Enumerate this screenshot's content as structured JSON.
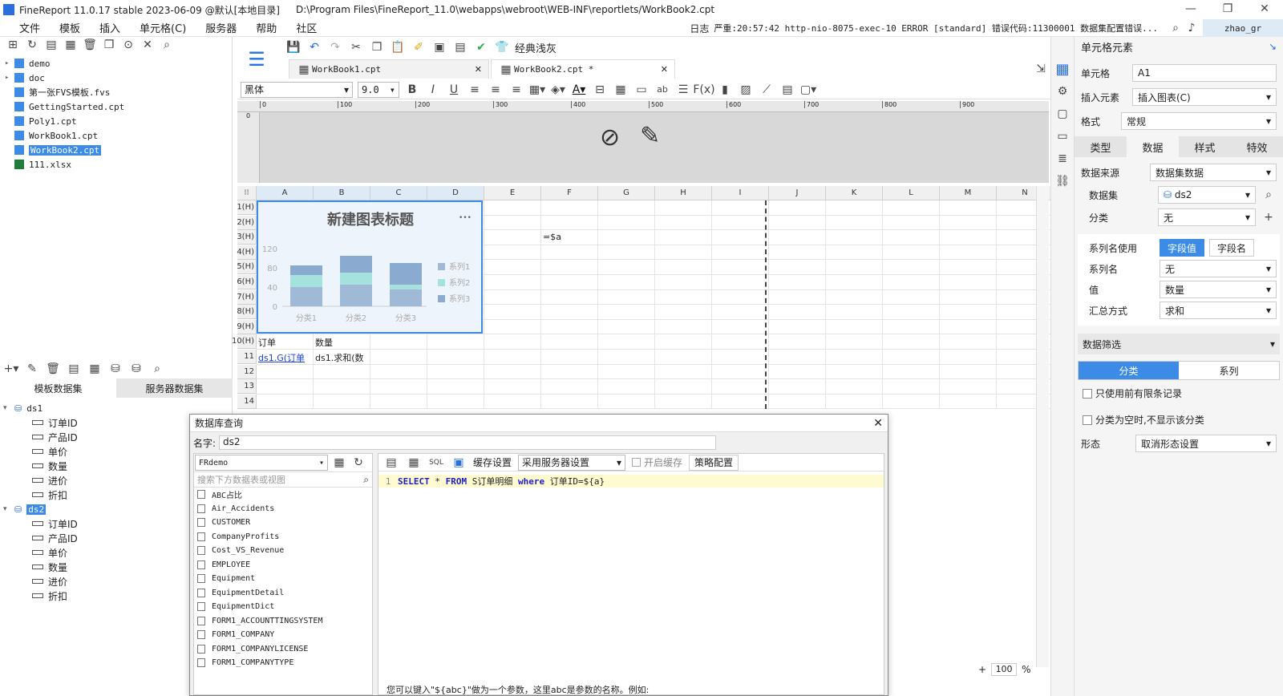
{
  "app": {
    "title": "FineReport 11.0.17 stable 2023-06-09 @默认[本地目录]",
    "path": "D:\\Program Files\\FineReport_11.0\\webapps\\webroot\\WEB-INF\\reportlets/WorkBook2.cpt"
  },
  "menu": [
    "文件",
    "模板",
    "插入",
    "单元格(C)",
    "服务器",
    "帮助",
    "社区"
  ],
  "status": {
    "log_label": "日志",
    "message": "严重:20:57:42 http-nio-8075-exec-10 ERROR [standard] 错误代码:11300001 数据集配置错误...",
    "user": "zhao_gr"
  },
  "toolbar": {
    "theme_label": "经典浅灰"
  },
  "tabs": [
    {
      "label": "WorkBook1.cpt"
    },
    {
      "label": "WorkBook2.cpt *"
    }
  ],
  "format": {
    "font": "黑体",
    "size": "9.0",
    "zoom": "100"
  },
  "ruler": [
    "0",
    "100",
    "200",
    "300",
    "400",
    "500",
    "600",
    "700",
    "800",
    "900"
  ],
  "file_tree": [
    {
      "name": "demo",
      "type": "folder"
    },
    {
      "name": "doc",
      "type": "folder"
    },
    {
      "name": "第一张FVS模板.fvs",
      "type": "fvs"
    },
    {
      "name": "GettingStarted.cpt",
      "type": "cpt"
    },
    {
      "name": "Poly1.cpt",
      "type": "cpt"
    },
    {
      "name": "WorkBook1.cpt",
      "type": "cpt"
    },
    {
      "name": "WorkBook2.cpt",
      "type": "cpt",
      "selected": true
    },
    {
      "name": "111.xlsx",
      "type": "xlsx"
    }
  ],
  "dataset_tabs": [
    "模板数据集",
    "服务器数据集"
  ],
  "datasets": [
    {
      "name": "ds1",
      "fields": [
        "订单ID",
        "产品ID",
        "单价",
        "数量",
        "进价",
        "折扣"
      ]
    },
    {
      "name": "ds2",
      "fields": [
        "订单ID",
        "产品ID",
        "单价",
        "数量",
        "进价",
        "折扣"
      ]
    }
  ],
  "sheet": {
    "columns": [
      "A",
      "B",
      "C",
      "D",
      "E",
      "F",
      "G",
      "H",
      "I",
      "J",
      "K",
      "L",
      "M",
      "N"
    ],
    "rows": [
      "1(H)",
      "2(H)",
      "3(H)",
      "4(H)",
      "5(H)",
      "6(H)",
      "7(H)",
      "8(H)",
      "9(H)",
      "10(H)",
      "11",
      "12",
      "13",
      "14"
    ],
    "cells": {
      "F3": "=$a",
      "A10": "订单",
      "B10": "数量",
      "A11": "ds1.G(订单",
      "B11": "ds1.求和(数"
    }
  },
  "chart_data": {
    "type": "bar",
    "title": "新建图表标题",
    "categories": [
      "分类1",
      "分类2",
      "分类3"
    ],
    "series": [
      {
        "name": "系列1",
        "values": [
          40,
          45,
          35
        ]
      },
      {
        "name": "系列2",
        "values": [
          25,
          25,
          10
        ]
      },
      {
        "name": "系列3",
        "values": [
          20,
          35,
          45
        ]
      }
    ],
    "ylim": [
      0,
      120
    ],
    "yticks": [
      "0",
      "40",
      "80",
      "120"
    ],
    "stacked": true,
    "legend": "right",
    "colors": [
      "#9fb9d6",
      "#a5e2dd",
      "#8aaad0"
    ],
    "more_label": "•••"
  },
  "right": {
    "header": "单元格元素",
    "cell_label": "单元格",
    "cell_value": "A1",
    "insert_label": "插入元素",
    "insert_value": "插入图表(C)",
    "format_label": "格式",
    "format_value": "常规",
    "tabs": [
      "类型",
      "数据",
      "样式",
      "特效"
    ],
    "source_label": "数据来源",
    "source_value": "数据集数据",
    "dataset_label": "数据集",
    "dataset_value": "ds2",
    "category_label": "分类",
    "category_value": "无",
    "series_use_label": "系列名使用",
    "series_use_options": [
      "字段值",
      "字段名"
    ],
    "series_name_label": "系列名",
    "series_name_value": "无",
    "value_label": "值",
    "value_value": "数量",
    "agg_label": "汇总方式",
    "agg_value": "求和",
    "filter_label": "数据筛选",
    "filter_tabs": [
      "分类",
      "系列"
    ],
    "check1": "只使用前有限条记录",
    "check2": "分类为空时,不显示该分类",
    "shape_label": "形态",
    "shape_value": "取消形态设置"
  },
  "dialog": {
    "title": "数据库查询",
    "name_label": "名字:",
    "name_value": "ds2",
    "connection": "FRdemo",
    "search_placeholder": "搜索下方数据表或视图",
    "cache_label": "缓存设置",
    "server_setting": "采用服务器设置",
    "enable_cache": "开启缓存",
    "strategy": "策略配置",
    "tables": [
      "ABC占比",
      "Air_Accidents",
      "CUSTOMER",
      "CompanyProfits",
      "Cost_VS_Revenue",
      "EMPLOYEE",
      "Equipment",
      "EquipmentDetail",
      "EquipmentDict",
      "FORM1_ACCOUNTTINGSYSTEM",
      "FORM1_COMPANY",
      "FORM1_COMPANYLICENSE",
      "FORM1_COMPANYTYPE"
    ],
    "sql": {
      "line": "1",
      "select": "SELECT",
      "star": "*",
      "from": "FROM",
      "table": "S订单明细",
      "where": "where",
      "cond": "订单ID=${a}"
    },
    "hint": "您可以键入\"${abc}\"做为一个参数，这里abc是参数的名称。例如:"
  }
}
